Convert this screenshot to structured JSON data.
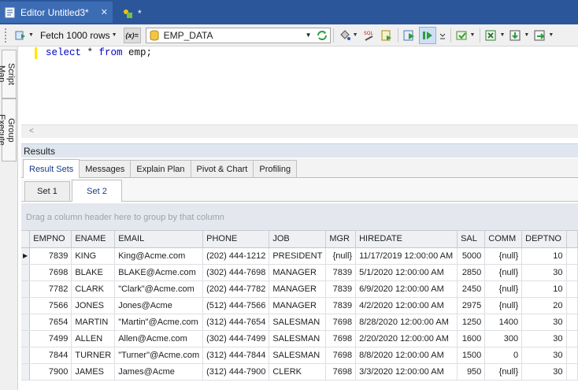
{
  "doc_tabs": [
    {
      "label": "Editor Untitled3*",
      "close": "✕"
    },
    {
      "label": "*"
    }
  ],
  "toolbar": {
    "fetch_label": "Fetch 1000 rows",
    "var_label": "(x)=",
    "connection": "EMP_DATA"
  },
  "side_tabs": [
    "Script Map",
    "Group Execute"
  ],
  "editor": {
    "kw1": "select",
    "star": " * ",
    "kw2": "from",
    "rest": " emp;",
    "scroll_left": "<"
  },
  "results": {
    "header": "Results",
    "tabs": [
      "Result Sets",
      "Messages",
      "Explain Plan",
      "Pivot & Chart",
      "Profiling"
    ],
    "active_tab": "Result Sets",
    "sets": [
      "Set 1",
      "Set 2"
    ],
    "active_set": "Set 2",
    "group_hint": "Drag a column header here to group by that column"
  },
  "grid": {
    "columns": [
      "EMPNO",
      "ENAME",
      "EMAIL",
      "PHONE",
      "JOB",
      "MGR",
      "HIREDATE",
      "SAL",
      "COMM",
      "DEPTNO"
    ],
    "rows": [
      [
        "7839",
        "KING",
        "King@Acme.com",
        "(202) 444-1212",
        "PRESIDENT",
        "{null}",
        "11/17/2019 12:00:00 AM",
        "5000",
        "{null}",
        "10"
      ],
      [
        "7698",
        "BLAKE",
        "BLAKE@Acme.com",
        "(302) 444-7698",
        "MANAGER",
        "7839",
        "5/1/2020 12:00:00 AM",
        "2850",
        "{null}",
        "30"
      ],
      [
        "7782",
        "CLARK",
        "\"Clark\"@Acme.com",
        "(202) 444-7782",
        "MANAGER",
        "7839",
        "6/9/2020 12:00:00 AM",
        "2450",
        "{null}",
        "10"
      ],
      [
        "7566",
        "JONES",
        "Jones@Acme",
        "(512) 444-7566",
        "MANAGER",
        "7839",
        "4/2/2020 12:00:00 AM",
        "2975",
        "{null}",
        "20"
      ],
      [
        "7654",
        "MARTIN",
        "\"Martin\"@Acme.com",
        "(312) 444-7654",
        "SALESMAN",
        "7698",
        "8/28/2020 12:00:00 AM",
        "1250",
        "1400",
        "30"
      ],
      [
        "7499",
        "ALLEN",
        "Allen@Acme.com",
        "(302) 444-7499",
        "SALESMAN",
        "7698",
        "2/20/2020 12:00:00 AM",
        "1600",
        "300",
        "30"
      ],
      [
        "7844",
        "TURNER",
        "\"Turner\"@Acme.com",
        "(312) 444-7844",
        "SALESMAN",
        "7698",
        "8/8/2020 12:00:00 AM",
        "1500",
        "0",
        "30"
      ],
      [
        "7900",
        "JAMES",
        "James@Acme",
        "(312) 444-7900",
        "CLERK",
        "7698",
        "3/3/2020 12:00:00 AM",
        "950",
        "{null}",
        "30"
      ]
    ]
  },
  "colors": {
    "tab_strip": "#2b579a",
    "keyword": "#0000c8"
  }
}
